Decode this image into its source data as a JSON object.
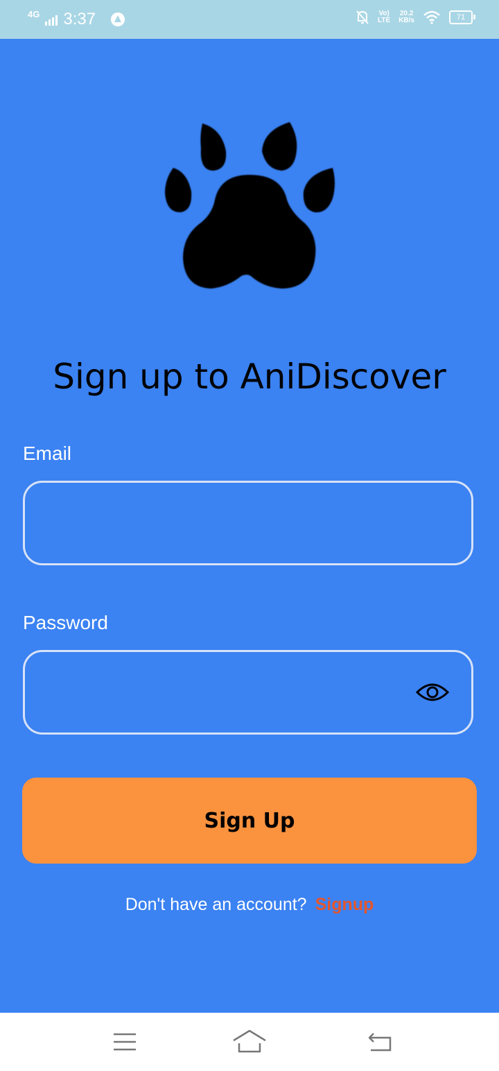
{
  "status": {
    "network": "4G",
    "time": "3:37",
    "volte_line1": "Vo)",
    "volte_line2": "LTE",
    "speed_value": "20.2",
    "speed_unit": "KB/s",
    "battery": "71"
  },
  "title": "Sign up to AniDiscover",
  "form": {
    "email_label": "Email",
    "email_value": "",
    "password_label": "Password",
    "password_value": "",
    "submit_label": "Sign Up"
  },
  "footer": {
    "prompt": "Don't have an account?",
    "link": "Signup"
  },
  "colors": {
    "background": "#3b82f2",
    "button": "#fa923e",
    "link": "#e4572e",
    "status_bar": "#a9d6e5"
  },
  "icons": [
    "paw-logo-icon",
    "eye-icon",
    "menu-icon",
    "home-icon",
    "back-icon"
  ]
}
